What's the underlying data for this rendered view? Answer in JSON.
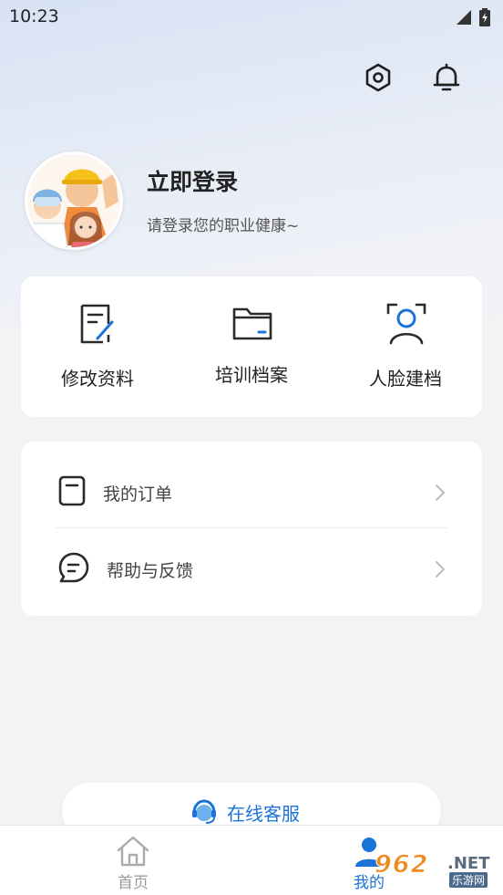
{
  "status_bar": {
    "time": "10:23"
  },
  "header": {
    "settings_icon": "hexagon-settings-icon",
    "notification_icon": "bell-icon"
  },
  "profile": {
    "title": "立即登录",
    "subtitle": "请登录您的职业健康~"
  },
  "quick_actions": [
    {
      "label": "修改资料",
      "icon": "edit-document-icon"
    },
    {
      "label": "培训档案",
      "icon": "folder-icon"
    },
    {
      "label": "人脸建档",
      "icon": "face-scan-icon"
    }
  ],
  "menu": [
    {
      "label": "我的订单",
      "icon": "order-icon"
    },
    {
      "label": "帮助与反馈",
      "icon": "feedback-chat-icon"
    }
  ],
  "service": {
    "label": "在线客服",
    "icon": "headset-icon"
  },
  "tabbar": {
    "home": "首页",
    "me": "我的"
  },
  "watermark": {
    "brand": "962",
    "suffix": ".NET",
    "sub": "乐游网"
  },
  "colors": {
    "accent": "#1a73d9",
    "background": "#f3f3f5",
    "watermark": "#f08a1c"
  }
}
